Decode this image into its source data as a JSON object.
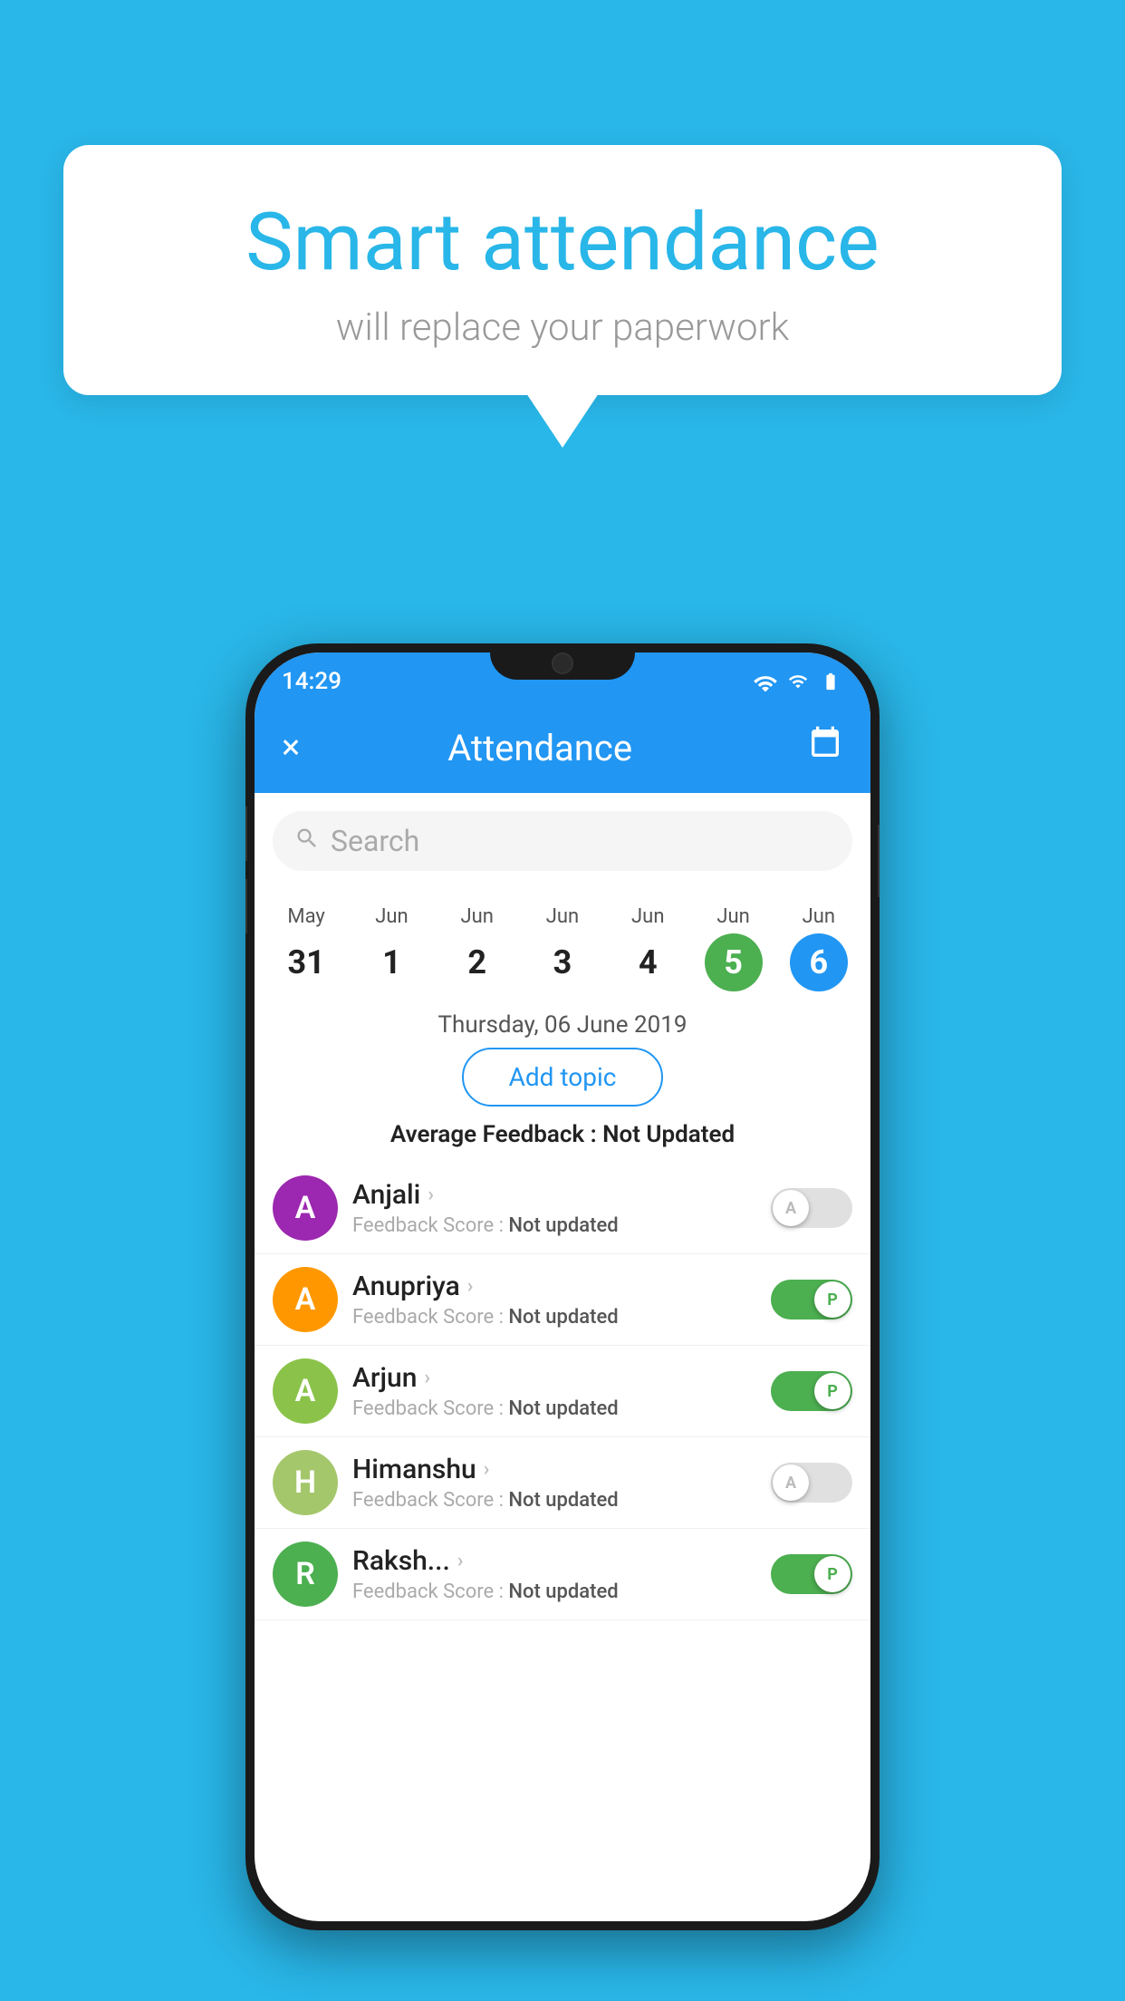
{
  "background_color": "#29b6e8",
  "speech_bubble": {
    "title": "Smart attendance",
    "subtitle": "will replace your paperwork"
  },
  "phone": {
    "status_bar": {
      "time": "14:29"
    },
    "app_bar": {
      "title": "Attendance",
      "close_label": "×",
      "calendar_icon": "📅"
    },
    "search": {
      "placeholder": "Search"
    },
    "calendar": {
      "days": [
        {
          "month": "May",
          "date": "31",
          "state": "normal"
        },
        {
          "month": "Jun",
          "date": "1",
          "state": "normal"
        },
        {
          "month": "Jun",
          "date": "2",
          "state": "normal"
        },
        {
          "month": "Jun",
          "date": "3",
          "state": "normal"
        },
        {
          "month": "Jun",
          "date": "4",
          "state": "normal"
        },
        {
          "month": "Jun",
          "date": "5",
          "state": "today"
        },
        {
          "month": "Jun",
          "date": "6",
          "state": "selected"
        }
      ]
    },
    "selected_date_label": "Thursday, 06 June 2019",
    "add_topic_label": "Add topic",
    "avg_feedback_label": "Average Feedback : ",
    "avg_feedback_value": "Not Updated",
    "students": [
      {
        "name": "Anjali",
        "avatar_letter": "A",
        "avatar_color": "#9c27b0",
        "feedback_label": "Feedback Score : ",
        "feedback_value": "Not updated",
        "toggle_state": "off",
        "toggle_letter": "A"
      },
      {
        "name": "Anupriya",
        "avatar_letter": "A",
        "avatar_color": "#ff9800",
        "feedback_label": "Feedback Score : ",
        "feedback_value": "Not updated",
        "toggle_state": "on",
        "toggle_letter": "P"
      },
      {
        "name": "Arjun",
        "avatar_letter": "A",
        "avatar_color": "#8bc34a",
        "feedback_label": "Feedback Score : ",
        "feedback_value": "Not updated",
        "toggle_state": "on",
        "toggle_letter": "P"
      },
      {
        "name": "Himanshu",
        "avatar_letter": "H",
        "avatar_color": "#a5c76b",
        "feedback_label": "Feedback Score : ",
        "feedback_value": "Not updated",
        "toggle_state": "off",
        "toggle_letter": "A"
      },
      {
        "name": "Raksh...",
        "avatar_letter": "R",
        "avatar_color": "#4caf50",
        "feedback_label": "Feedback Score : ",
        "feedback_value": "Not updated",
        "toggle_state": "on",
        "toggle_letter": "P"
      }
    ]
  }
}
